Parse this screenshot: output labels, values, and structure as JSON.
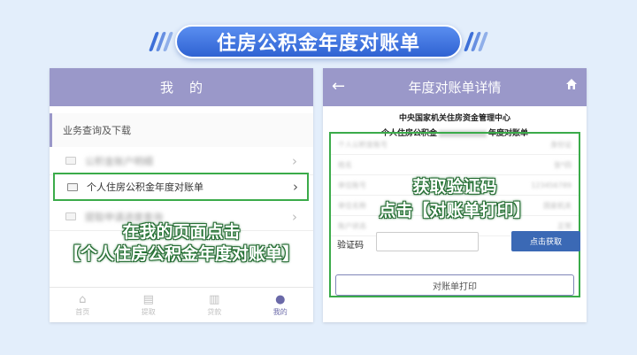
{
  "banner": {
    "title": "住房公积金年度对账单"
  },
  "left": {
    "header": "我的",
    "section": "业务查询及下载",
    "rows": [
      "公积金账户明细",
      "个人住房公积金年度对账单",
      "提取申请进度查询"
    ],
    "tabs": [
      "首页",
      "提取",
      "贷款",
      "我的"
    ],
    "overlay": {
      "line1": "在我的页面点击",
      "line2": "【个人住房公积金年度对账单】"
    }
  },
  "right": {
    "header": "年度对账单详情",
    "org": "中央国家机关住房资金管理中心",
    "acct_prefix": "个人住房公积金",
    "acct_suffix": "年度对账单",
    "info_rows": [
      [
        "个人公积金账号",
        "身份证"
      ],
      [
        "姓名",
        "张*四"
      ],
      [
        "单位账号",
        "123456789"
      ],
      [
        "单位名称",
        "国家机关"
      ],
      [
        "账户状态",
        "正常"
      ]
    ],
    "captcha_label": "验证码",
    "get_code": "点击获取",
    "print": "对账单打印",
    "overlay": {
      "line1": "获取验证码",
      "line2": "点击【对账单打印】"
    }
  },
  "colors": {
    "accent": "#9a98c9",
    "highlight": "#3bab4a",
    "button": "#3b69b5",
    "banner": "#2f62d2"
  }
}
